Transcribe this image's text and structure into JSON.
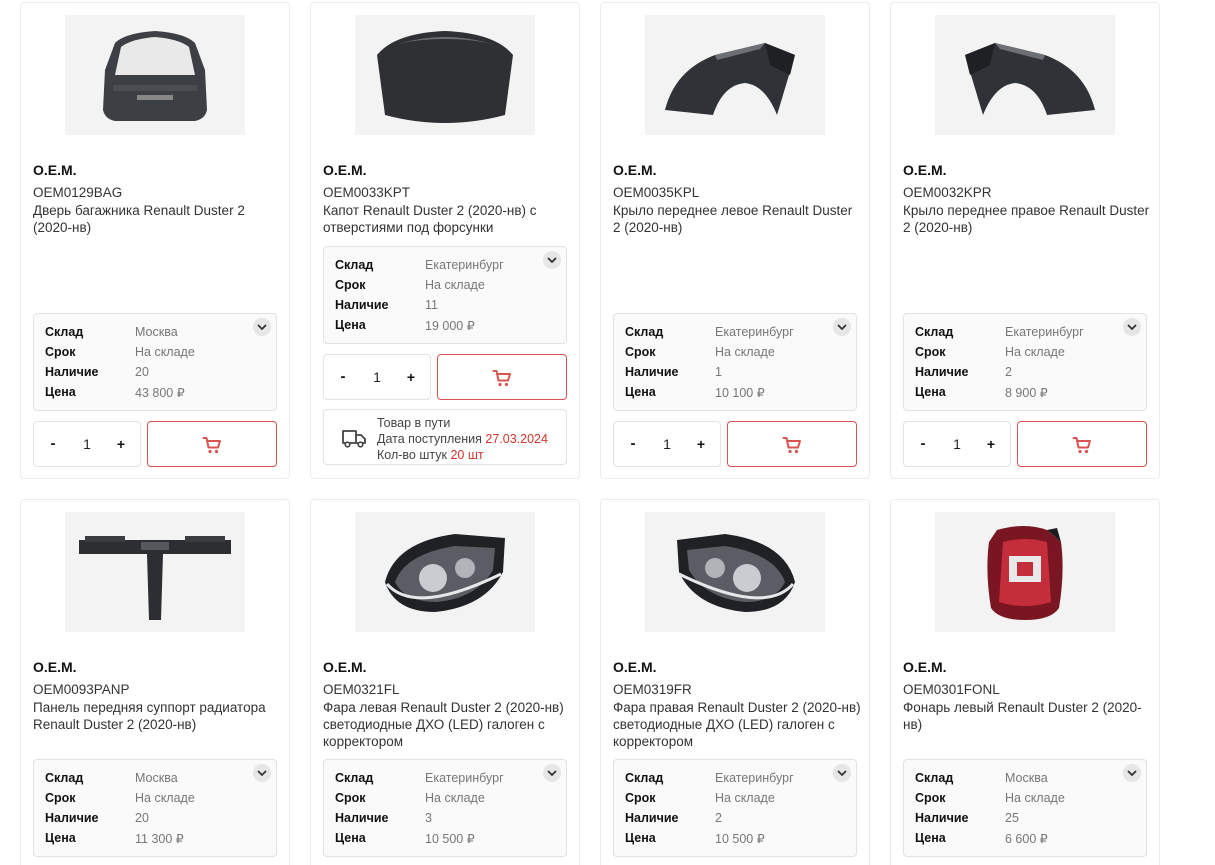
{
  "labels": {
    "warehouse": "Склад",
    "term": "Срок",
    "stock": "Наличие",
    "price": "Цена",
    "minus": "-",
    "plus": "+"
  },
  "colors": {
    "accent": "#d9534f",
    "highlight": "#d0342c",
    "border": "#e2e2e2"
  },
  "products": [
    {
      "brand": "O.E.M.",
      "sku": "OEM0129BAG",
      "title": "Дверь багажника Renault Duster 2 (2020-нв)",
      "image": "tailgate",
      "warehouse": "Москва",
      "term": "На складе",
      "stock": "20",
      "price": "43 800 ₽",
      "qty": "1"
    },
    {
      "brand": "O.E.M.",
      "sku": "OEM0033KPT",
      "title": "Капот Renault Duster 2 (2020-нв) с отверстиями под форсунки",
      "image": "hood",
      "warehouse": "Екатеринбург",
      "term": "На складе",
      "stock": "11",
      "price": "19 000 ₽",
      "qty": "1",
      "transit": {
        "line1": "Товар в пути",
        "line2_label": "Дата поступления ",
        "line2_value": "27.03.2024",
        "line3_label": "Кол-во штук ",
        "line3_value": "20 шт"
      }
    },
    {
      "brand": "O.E.M.",
      "sku": "OEM0035KPL",
      "title": "Крыло переднее левое Renault Duster 2 (2020-нв)",
      "image": "fender-left",
      "warehouse": "Екатеринбург",
      "term": "На складе",
      "stock": "1",
      "price": "10 100 ₽",
      "qty": "1"
    },
    {
      "brand": "O.E.M.",
      "sku": "OEM0032KPR",
      "title": "Крыло переднее правое Renault Duster 2 (2020-нв)",
      "image": "fender-right",
      "warehouse": "Екатеринбург",
      "term": "На складе",
      "stock": "2",
      "price": "8 900 ₽",
      "qty": "1"
    },
    {
      "brand": "O.E.M.",
      "sku": "OEM0093PANP",
      "title": "Панель передняя суппорт радиатора Renault Duster 2 (2020-нв)",
      "image": "radiator-panel",
      "warehouse": "Москва",
      "term": "На складе",
      "stock": "20",
      "price": "11 300 ₽"
    },
    {
      "brand": "O.E.M.",
      "sku": "OEM0321FL",
      "title": "Фара левая Renault Duster 2 (2020-нв) светодиодные ДХО (LED) галоген с корректором",
      "image": "headlight-left",
      "warehouse": "Екатеринбург",
      "term": "На складе",
      "stock": "3",
      "price": "10 500 ₽"
    },
    {
      "brand": "O.E.M.",
      "sku": "OEM0319FR",
      "title": "Фара правая Renault Duster 2 (2020-нв) светодиодные ДХО (LED) галоген с корректором",
      "image": "headlight-right",
      "warehouse": "Екатеринбург",
      "term": "На складе",
      "stock": "2",
      "price": "10 500 ₽"
    },
    {
      "brand": "O.E.M.",
      "sku": "OEM0301FONL",
      "title": "Фонарь левый Renault Duster 2 (2020-нв)",
      "image": "tail-lamp",
      "warehouse": "Москва",
      "term": "На складе",
      "stock": "25",
      "price": "6 600 ₽"
    }
  ]
}
